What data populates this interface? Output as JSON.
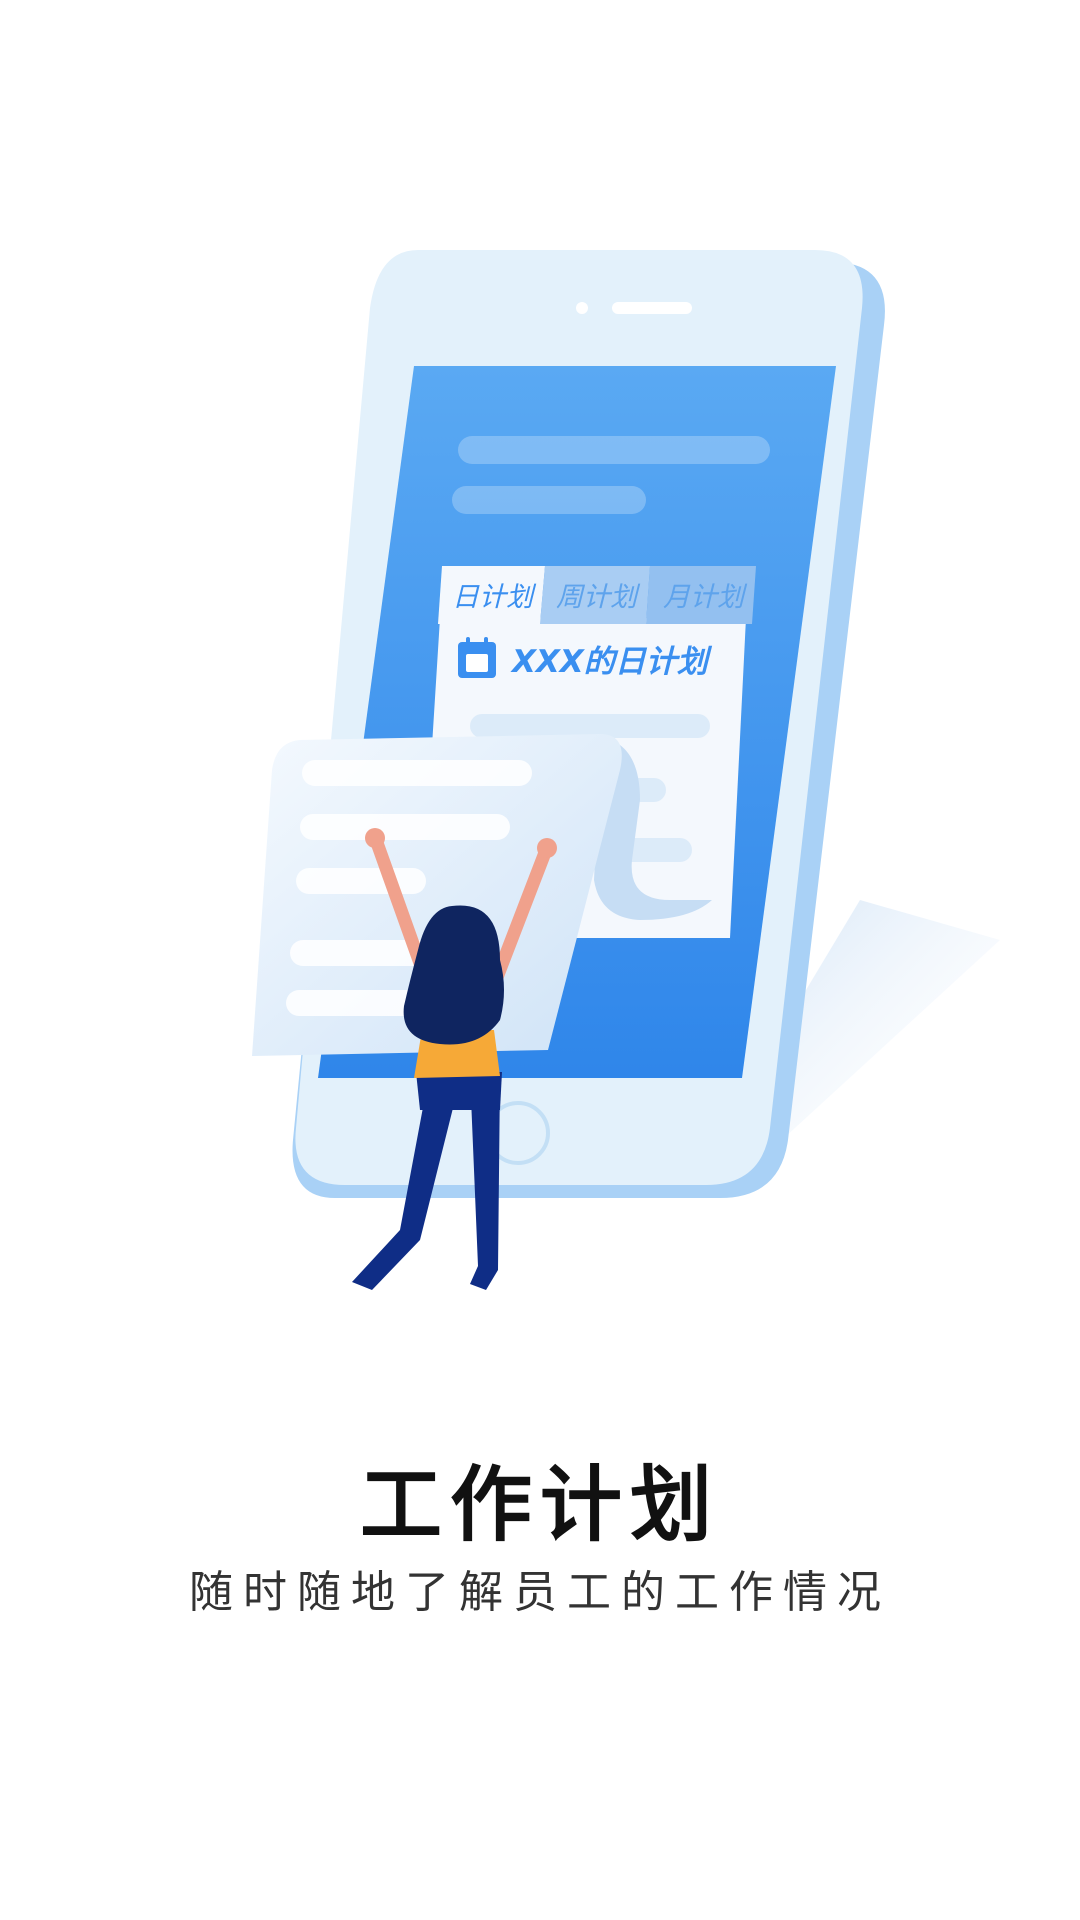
{
  "illustration": {
    "tabs": [
      "日计划",
      "周计划",
      "月计划"
    ],
    "card_title": "XXX的日计划",
    "calendar_icon": "calendar-icon",
    "colors": {
      "phone_frame": "#e3f1fb",
      "screen": "#3f95ee",
      "accent": "#3a8ff0",
      "hair": "#0f2560",
      "shirt": "#f6a937",
      "pants": "#0f2d86",
      "skin": "#f0a18c"
    }
  },
  "title": "工作计划",
  "subtitle": "随时随地了解员工的工作情况"
}
